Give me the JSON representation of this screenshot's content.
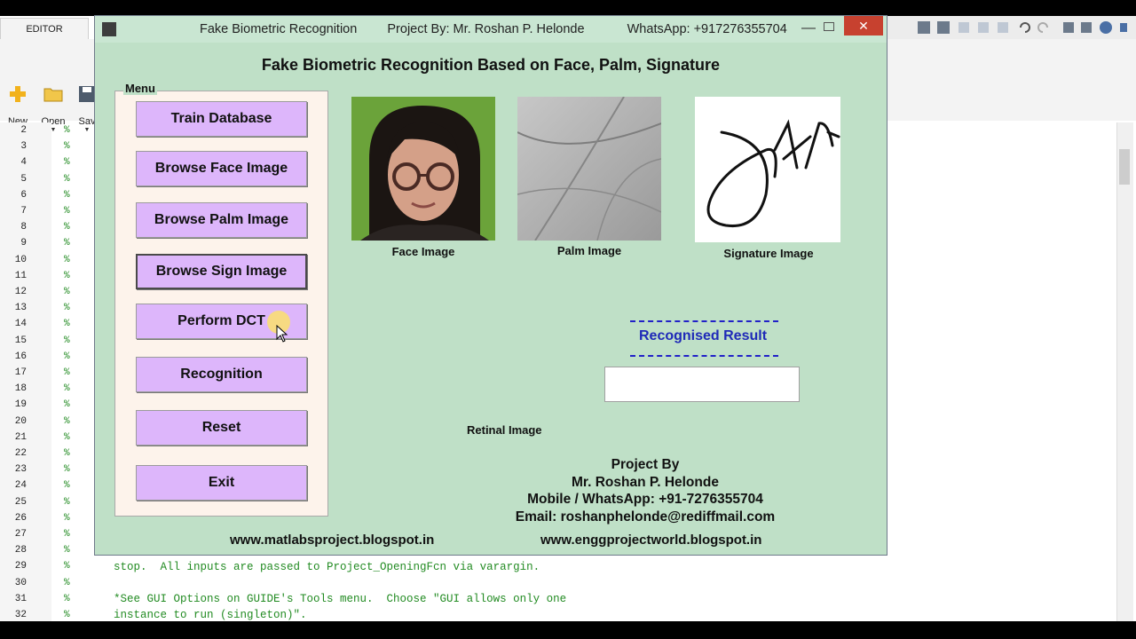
{
  "editor": {
    "tab_label": "EDITOR",
    "toolbar": [
      {
        "label": "New",
        "icon": "plus-icon"
      },
      {
        "label": "Open",
        "icon": "folder-icon"
      },
      {
        "label": "Sav",
        "icon": "save-icon"
      }
    ],
    "line_numbers": [
      "2",
      "3",
      "4",
      "5",
      "6",
      "7",
      "8",
      "9",
      "10",
      "11",
      "12",
      "13",
      "14",
      "15",
      "16",
      "17",
      "18",
      "19",
      "20",
      "21",
      "22",
      "23",
      "24",
      "25",
      "26",
      "27",
      "28",
      "29",
      "30",
      "31",
      "32"
    ],
    "code_lines": [
      "stop.  All inputs are passed to Project_OpeningFcn via varargin.",
      "",
      "*See GUI Options on GUIDE's Tools menu.  Choose \"GUI allows only one",
      "instance to run (singleton)\"."
    ],
    "comment_char": "%"
  },
  "window": {
    "title_part1": "Fake Biometric  Recognition",
    "title_part2": "Project By: Mr. Roshan P. Helonde",
    "title_part3": "WhatsApp: +917276355704",
    "minimize": "—",
    "close": "✕"
  },
  "app": {
    "heading": "Fake Biometric Recognition Based on Face, Palm, Signature",
    "menu_label": "Menu",
    "buttons": {
      "train": "Train Database",
      "face": "Browse Face Image",
      "palm": "Browse Palm Image",
      "sign": "Browse Sign Image",
      "dct": "Perform DCT",
      "recognition": "Recognition",
      "reset": "Reset",
      "exit": "Exit"
    },
    "images": {
      "face_label": "Face Image",
      "palm_label": "Palm Image",
      "signature_label": "Signature Image"
    },
    "result": {
      "title": "Recognised Result",
      "value": ""
    },
    "retinal_label": "Retinal Image",
    "credits": {
      "line1": "Project By",
      "line2": "Mr. Roshan P. Helonde",
      "line3": "Mobile / WhatsApp: +91-7276355704",
      "line4": "Email: roshanphelonde@rediffmail.com"
    },
    "link1": "www.matlabsproject.blogspot.in",
    "link2": "www.enggprojectworld.blogspot.in"
  },
  "colors": {
    "figure_bg": "#bfe0c7",
    "button_bg": "#ddb6fb",
    "menu_panel_bg": "#fdf3eb",
    "result_title": "#1f2ab8",
    "close_button": "#c7412f"
  }
}
